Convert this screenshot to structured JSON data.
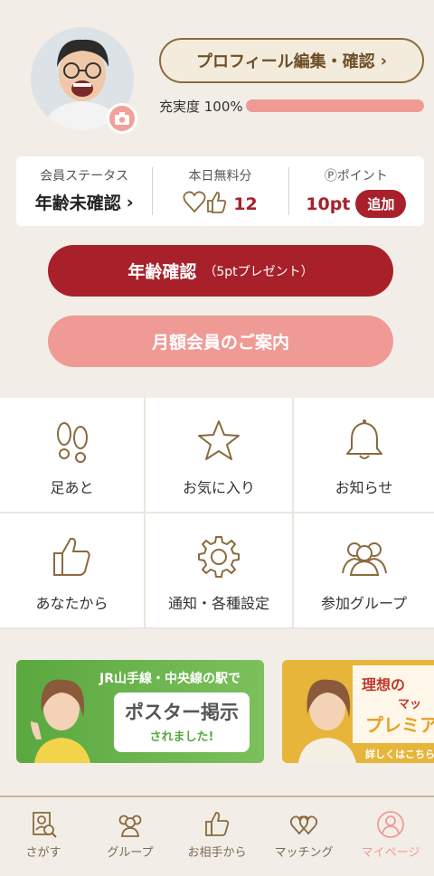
{
  "profile": {
    "edit_button": "プロフィール編集・確認",
    "fill_label": "充実度 100%",
    "fill_ratio": 1.0
  },
  "status": {
    "member": {
      "label": "会員ステータス",
      "value": "年齢未確認"
    },
    "free": {
      "label": "本日無料分",
      "value": "12"
    },
    "points": {
      "label": "Ⓟポイント",
      "value": "10pt",
      "add_label": "追加"
    }
  },
  "buttons": {
    "age_verify": "年齢確認",
    "age_verify_note": "（5ptプレゼント）",
    "monthly": "月額会員のご案内"
  },
  "menu": [
    {
      "label": "足あと",
      "icon": "footprints-icon"
    },
    {
      "label": "お気に入り",
      "icon": "star-icon"
    },
    {
      "label": "お知らせ",
      "icon": "bell-icon"
    },
    {
      "label": "あなたから",
      "icon": "thumbs-up-icon"
    },
    {
      "label": "通知・各種設定",
      "icon": "gear-icon"
    },
    {
      "label": "参加グループ",
      "icon": "group-icon"
    }
  ],
  "banners": {
    "poster": {
      "title": "JR山手線・中央線の駅で",
      "main": "ポスター掲示",
      "sub": "されました!"
    },
    "premium": {
      "line1": "理想の",
      "line2": "マッ",
      "line3": "プレミア",
      "more": "詳しくはこちら"
    }
  },
  "tabs": [
    {
      "label": "さがす",
      "icon": "search-profile-icon"
    },
    {
      "label": "グループ",
      "icon": "group-icon"
    },
    {
      "label": "お相手から",
      "icon": "thumbs-up-icon"
    },
    {
      "label": "マッチング",
      "icon": "hearts-icon"
    },
    {
      "label": "マイページ",
      "icon": "person-icon",
      "active": true
    }
  ],
  "colors": {
    "accent_red": "#a8202a",
    "accent_pink": "#f09a95",
    "brown": "#8b6a3e",
    "background": "#f2eee7"
  }
}
